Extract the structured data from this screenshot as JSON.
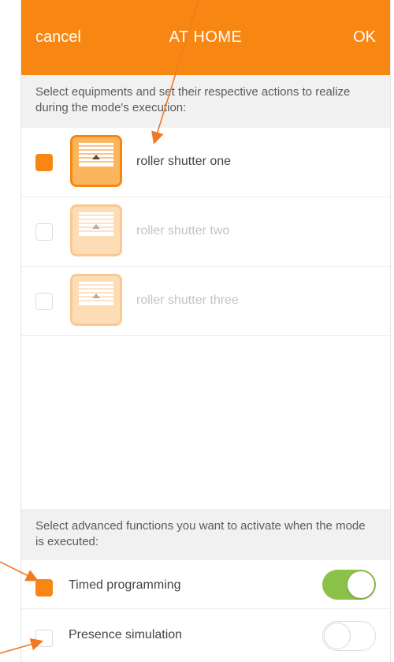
{
  "header": {
    "cancel_label": "cancel",
    "title": "AT HOME",
    "ok_label": "OK",
    "color": "#f78712"
  },
  "equipment_note": "Select equipments and set their respective actions to realize during the mode's execution:",
  "equipments": [
    {
      "label": "roller shutter one",
      "checked": true,
      "icon": "roller-shutter-icon"
    },
    {
      "label": "roller shutter two",
      "checked": false,
      "icon": "roller-shutter-icon"
    },
    {
      "label": "roller shutter three",
      "checked": false,
      "icon": "roller-shutter-icon"
    }
  ],
  "advanced_note": "Select advanced functions you want to activate when the mode is executed:",
  "advanced": [
    {
      "label": "Timed programming",
      "checked": true,
      "toggle_on": true
    },
    {
      "label": "Presence simulation",
      "checked": false,
      "toggle_on": false
    }
  ],
  "colors": {
    "accent": "#f78712",
    "toggle_on": "#8cc24a",
    "annotation_arrow": "#f07a23"
  }
}
